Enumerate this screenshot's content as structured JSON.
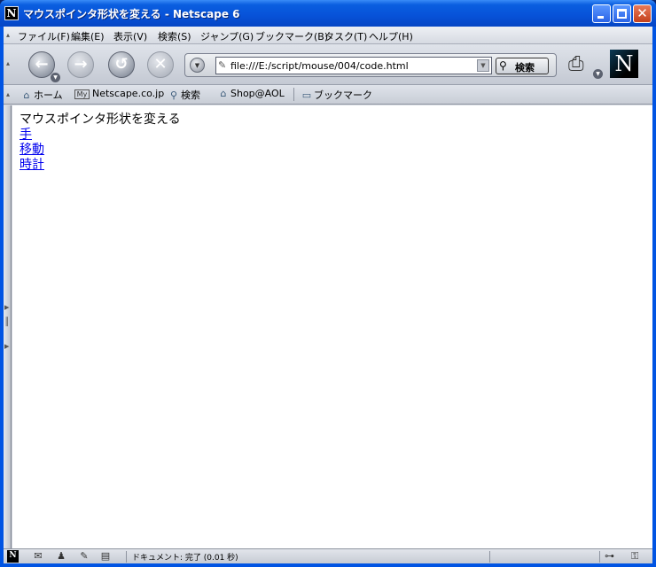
{
  "window": {
    "title": "マウスポインタ形状を変える - Netscape 6",
    "logo_letter": "N"
  },
  "menu": {
    "items": [
      {
        "label": "ファイル(F)"
      },
      {
        "label": "編集(E)"
      },
      {
        "label": "表示(V)"
      },
      {
        "label": "検索(S)"
      },
      {
        "label": "ジャンプ(G)"
      },
      {
        "label": "ブックマーク(B)"
      },
      {
        "label": "タスク(T)"
      },
      {
        "label": "ヘルプ(H)"
      }
    ]
  },
  "navbar": {
    "url": "file:///E:/script/mouse/004/code.html",
    "search_label": "検索",
    "brand_letter": "N"
  },
  "personal_toolbar": {
    "items": [
      {
        "icon": "home-icon",
        "label": "ホーム"
      },
      {
        "icon": "my-netscape-icon",
        "label": "Netscape.co.jp"
      },
      {
        "icon": "search-icon",
        "label": "検索"
      },
      {
        "icon": "shop-icon",
        "label": "Shop@AOL"
      },
      {
        "icon": "folder-icon",
        "label": "ブックマーク"
      }
    ],
    "my_badge": "My"
  },
  "page": {
    "heading": "マウスポインタ形状を変える",
    "links": [
      {
        "label": "手"
      },
      {
        "label": "移動"
      },
      {
        "label": "時計"
      }
    ]
  },
  "status": {
    "text": "ドキュメント: 完了 (0.01 秒)"
  },
  "colors": {
    "titlebar": "#0a5ee0",
    "link": "#0000ee",
    "chrome": "#d4d8e0"
  }
}
